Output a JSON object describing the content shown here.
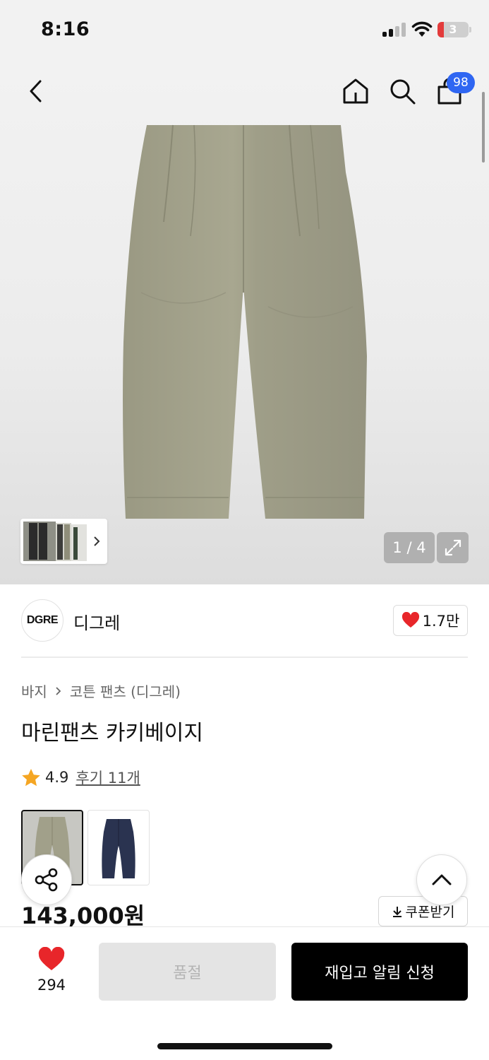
{
  "status_bar": {
    "time": "8:16",
    "battery": "3"
  },
  "nav": {
    "cart_count": "98"
  },
  "gallery": {
    "counter": "1 / 4"
  },
  "brand": {
    "logo_text": "DGRE",
    "name": "디그레",
    "likes": "1.7만"
  },
  "product": {
    "breadcrumb": [
      "바지",
      "코튼 팬츠 (디그레)"
    ],
    "title": "마린팬츠 카키베이지",
    "rating": "4.9",
    "review_link": "후기 11개",
    "price": "143,000원",
    "coupon_label": "쿠폰받기",
    "color_options": [
      "khaki-beige",
      "navy"
    ]
  },
  "bottom_bar": {
    "like_count": "294",
    "soldout_label": "품절",
    "restock_label": "재입고 알림 신청"
  },
  "colors": {
    "accent_blue": "#2f66f2",
    "heart_red": "#e8262a",
    "star_orange": "#f5a623",
    "pants_khaki": "#a1a08a",
    "pants_navy": "#2a3350"
  },
  "icons": [
    "back-icon",
    "home-icon",
    "search-icon",
    "bag-icon",
    "chevron-right-icon",
    "expand-icon",
    "heart-icon",
    "star-icon",
    "share-icon",
    "chevron-up-icon",
    "download-icon"
  ]
}
